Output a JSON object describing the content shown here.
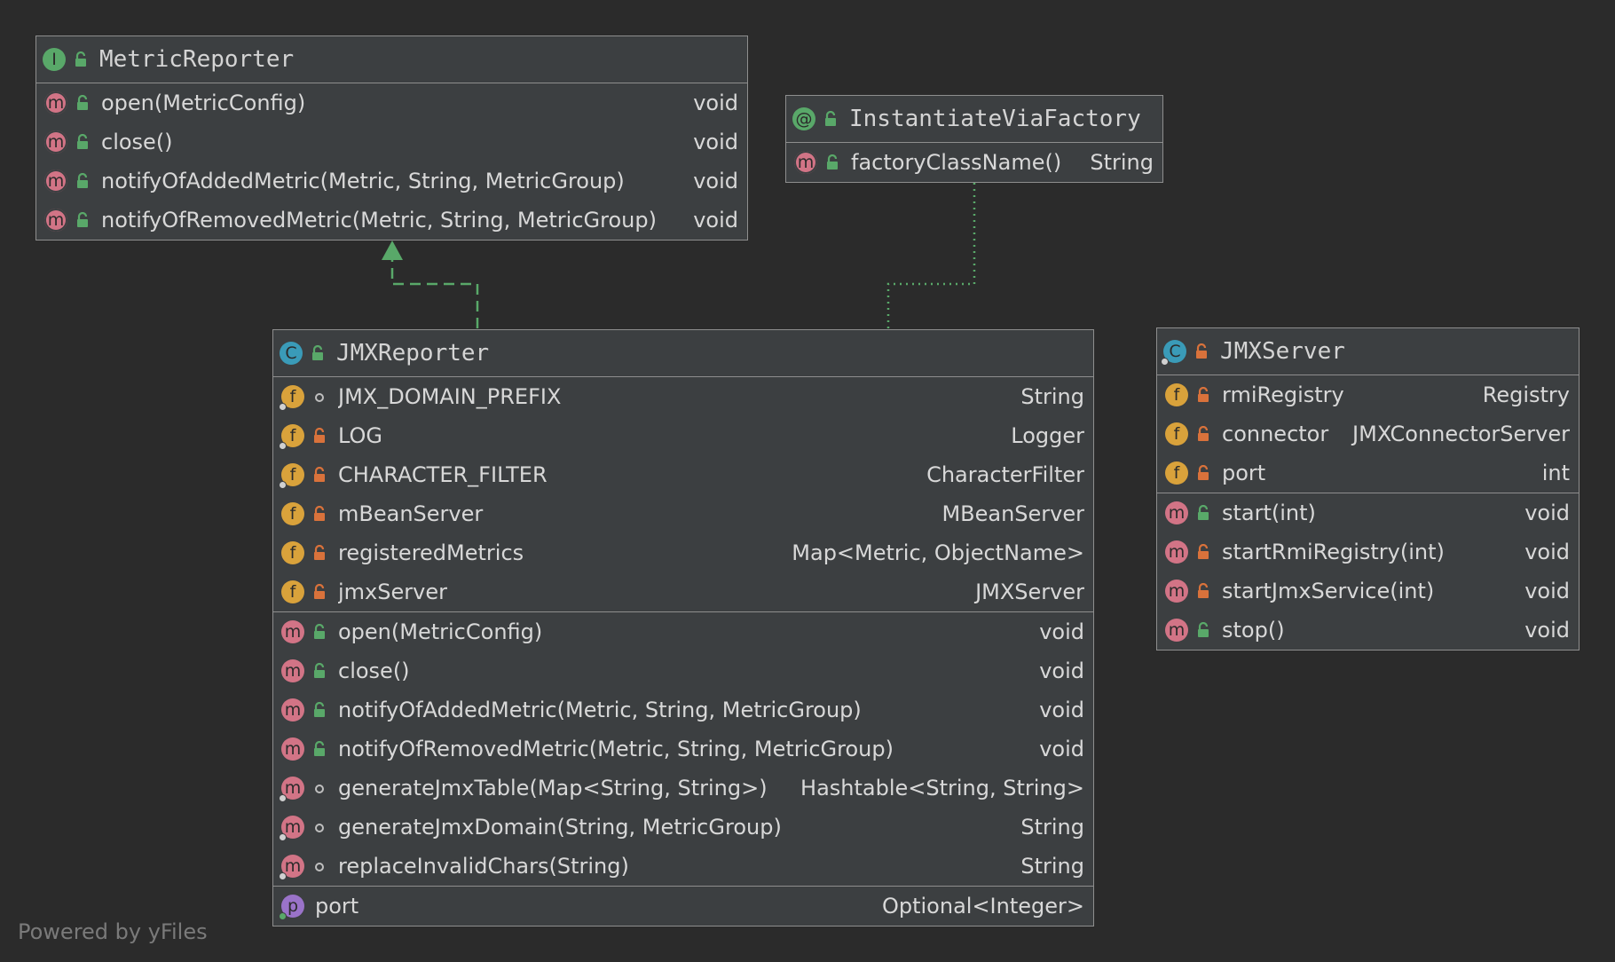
{
  "colors": {
    "background": "#2b2b2b",
    "box_fill": "#3c3f41",
    "border": "#8e8e8e",
    "text": "#d8d8d8",
    "interface_icon": "#59a869",
    "annotation_icon": "#59a869",
    "class_icon": "#3a9bb8",
    "field_icon": "#d9a23b",
    "method_icon": "#d27486",
    "property_icon": "#9a73c9",
    "public_lock": "#59a869",
    "private_lock": "#d9723b",
    "package_dot": "#bfbfbf",
    "connector": "#59a869"
  },
  "diagram": {
    "footer": "Powered by yFiles",
    "classes": [
      {
        "id": "metric-reporter",
        "kind_letter": "I",
        "kind_color": "#59a869",
        "visibility": "public",
        "title": "MetricReporter",
        "sections": [
          [
            {
              "icon": "m",
              "abstract": true,
              "visibility": "public",
              "name": "open(MetricConfig)",
              "type": "void"
            },
            {
              "icon": "m",
              "abstract": true,
              "visibility": "public",
              "name": "close()",
              "type": "void"
            },
            {
              "icon": "m",
              "abstract": true,
              "visibility": "public",
              "name": "notifyOfAddedMetric(Metric, String, MetricGroup)",
              "type": "void"
            },
            {
              "icon": "m",
              "abstract": true,
              "visibility": "public",
              "name": "notifyOfRemovedMetric(Metric, String, MetricGroup)",
              "type": "void"
            }
          ]
        ]
      },
      {
        "id": "instantiate-via-factory",
        "kind_letter": "@",
        "kind_color": "#59a869",
        "visibility": "public",
        "title": "InstantiateViaFactory",
        "sections": [
          [
            {
              "icon": "m",
              "abstract": true,
              "visibility": "public",
              "name": "factoryClassName()",
              "type": "String"
            }
          ]
        ]
      },
      {
        "id": "jmx-reporter",
        "kind_letter": "C",
        "kind_color": "#3a9bb8",
        "visibility": "public",
        "title": "JMXReporter",
        "sections": [
          [
            {
              "icon": "f",
              "badge": true,
              "visibility": "package",
              "name": "JMX_DOMAIN_PREFIX",
              "type": "String"
            },
            {
              "icon": "f",
              "badge": true,
              "visibility": "private",
              "name": "LOG",
              "type": "Logger"
            },
            {
              "icon": "f",
              "badge": true,
              "visibility": "private",
              "name": "CHARACTER_FILTER",
              "type": "CharacterFilter"
            },
            {
              "icon": "f",
              "visibility": "private",
              "name": "mBeanServer",
              "type": "MBeanServer"
            },
            {
              "icon": "f",
              "visibility": "private",
              "name": "registeredMetrics",
              "type": "Map<Metric, ObjectName>"
            },
            {
              "icon": "f",
              "visibility": "private",
              "name": "jmxServer",
              "type": "JMXServer"
            }
          ],
          [
            {
              "icon": "m",
              "visibility": "public",
              "name": "open(MetricConfig)",
              "type": "void"
            },
            {
              "icon": "m",
              "visibility": "public",
              "name": "close()",
              "type": "void"
            },
            {
              "icon": "m",
              "visibility": "public",
              "name": "notifyOfAddedMetric(Metric, String, MetricGroup)",
              "type": "void"
            },
            {
              "icon": "m",
              "visibility": "public",
              "name": "notifyOfRemovedMetric(Metric, String, MetricGroup)",
              "type": "void"
            },
            {
              "icon": "m",
              "badge": true,
              "visibility": "package",
              "name": "generateJmxTable(Map<String, String>)",
              "type": "Hashtable<String, String>"
            },
            {
              "icon": "m",
              "badge": true,
              "visibility": "package",
              "name": "generateJmxDomain(String, MetricGroup)",
              "type": "String"
            },
            {
              "icon": "m",
              "badge": true,
              "visibility": "package",
              "name": "replaceInvalidChars(String)",
              "type": "String"
            }
          ],
          [
            {
              "icon": "p",
              "badge_green": true,
              "visibility": "none",
              "name": "port",
              "type": "Optional<Integer>"
            }
          ]
        ]
      },
      {
        "id": "jmx-server",
        "kind_letter": "C",
        "kind_color": "#3a9bb8",
        "badge": true,
        "visibility": "private",
        "title": "JMXServer",
        "sections": [
          [
            {
              "icon": "f",
              "visibility": "private",
              "name": "rmiRegistry",
              "type": "Registry"
            },
            {
              "icon": "f",
              "visibility": "private",
              "name": "connector",
              "type": "JMXConnectorServer"
            },
            {
              "icon": "f",
              "visibility": "private",
              "name": "port",
              "type": "int"
            }
          ],
          [
            {
              "icon": "m",
              "visibility": "public",
              "name": "start(int)",
              "type": "void"
            },
            {
              "icon": "m",
              "visibility": "private",
              "name": "startRmiRegistry(int)",
              "type": "void"
            },
            {
              "icon": "m",
              "visibility": "private",
              "name": "startJmxService(int)",
              "type": "void"
            },
            {
              "icon": "m",
              "visibility": "public",
              "name": "stop()",
              "type": "void"
            }
          ]
        ]
      }
    ]
  }
}
